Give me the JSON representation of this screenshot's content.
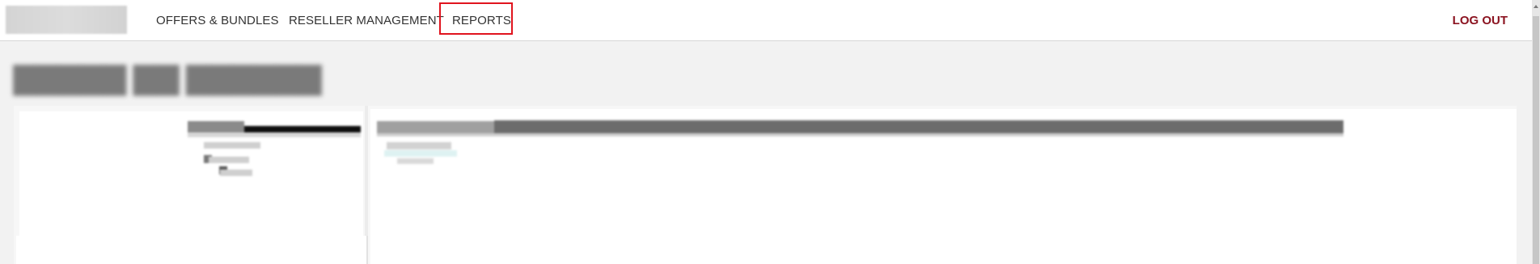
{
  "nav": {
    "items": [
      {
        "label": "OFFERS & BUNDLES"
      },
      {
        "label": "RESELLER MANAGEMENT"
      },
      {
        "label": "REPORTS"
      }
    ],
    "logout_label": "LOG OUT"
  },
  "colors": {
    "highlight": "#e0141e",
    "logout": "#8b1320"
  }
}
